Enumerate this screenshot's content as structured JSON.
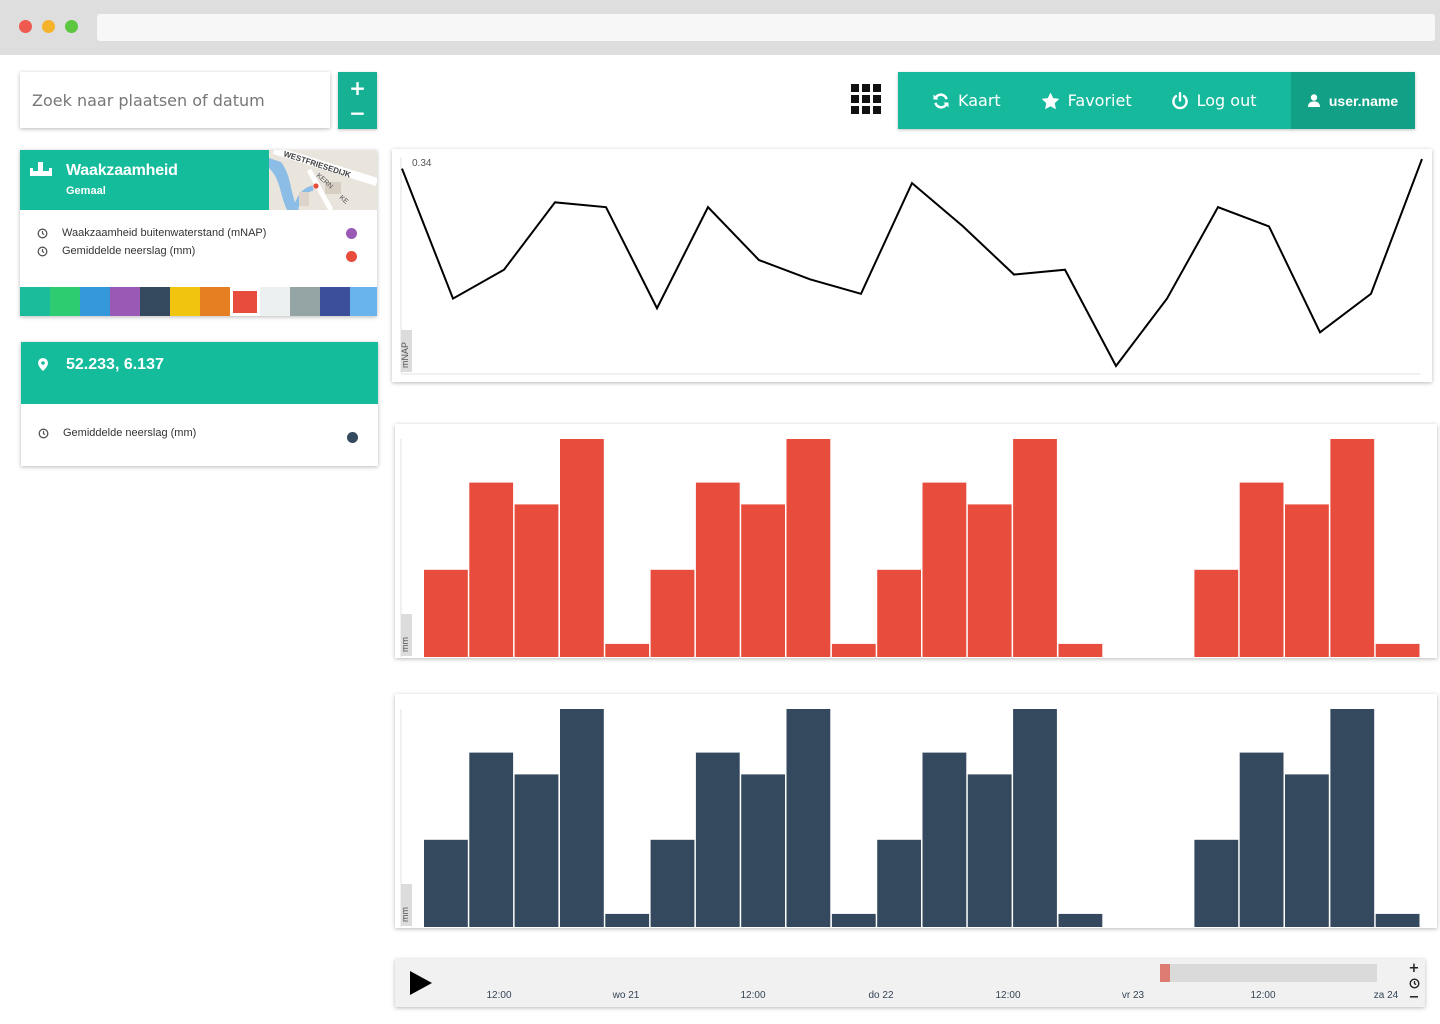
{
  "search": {
    "placeholder": "Zoek naar plaatsen of datum"
  },
  "zoom": {
    "in": "+",
    "out": "−"
  },
  "nav": {
    "kaart": "Kaart",
    "favoriet": "Favoriet",
    "logout": "Log out",
    "user": "user.name",
    "icons": [
      "apps-grid-icon",
      "refresh-icon",
      "star-icon",
      "power-icon",
      "user-icon"
    ]
  },
  "asset_card": {
    "title": "Waakzaamheid",
    "subtitle": "Gemaal",
    "map_labels": [
      "WESTFRIESEDIJK",
      "KERN",
      "KE"
    ],
    "series": [
      {
        "label": "Waakzaamheid buitenwaterstand (mNAP)",
        "color": "#9b59b6"
      },
      {
        "label": "Gemiddelde neerslag (mm)",
        "color": "#e74c3c"
      }
    ],
    "palette": [
      "#1abc9c",
      "#2ecc71",
      "#3498db",
      "#9b59b6",
      "#34495e",
      "#f1c40f",
      "#e67e22",
      "#e74c3c",
      "#ecf0f1",
      "#95a5a6",
      "#3b4f9a",
      "#6ab4ee"
    ],
    "selected_color": "#e74c3c"
  },
  "point_card": {
    "title": "52.233, 6.137",
    "series": [
      {
        "label": "Gemiddelde neerslag (mm)",
        "color": "#34495e"
      }
    ]
  },
  "chart_data": [
    {
      "type": "line",
      "ylabel": "mNAP",
      "ymax_label": "0.34",
      "color": "#000000",
      "x": [
        0,
        1,
        2,
        3,
        4,
        5,
        6,
        7,
        8,
        9,
        10,
        11,
        12,
        13,
        14,
        15,
        16,
        17,
        18,
        19
      ],
      "values": [
        0.32,
        0.05,
        0.11,
        0.25,
        0.24,
        0.03,
        0.24,
        0.13,
        0.09,
        0.06,
        0.29,
        0.2,
        0.1,
        0.11,
        -0.09,
        0.05,
        0.24,
        0.2,
        -0.02,
        0.06,
        0.34
      ],
      "ylim": [
        -0.09,
        0.34
      ]
    },
    {
      "type": "bar",
      "ylabel": "mm",
      "color": "#e74c3c",
      "values": [
        4,
        8,
        7,
        10,
        0.6,
        4,
        8,
        7,
        10,
        0.6,
        4,
        8,
        7,
        10,
        0.6,
        0,
        0,
        4,
        8,
        7,
        10,
        0.6
      ],
      "ylim": [
        0,
        10
      ]
    },
    {
      "type": "bar",
      "ylabel": "mm",
      "color": "#34495e",
      "values": [
        4,
        8,
        7,
        10,
        0.6,
        4,
        8,
        7,
        10,
        0.6,
        4,
        8,
        7,
        10,
        0.6,
        0,
        0,
        4,
        8,
        7,
        10,
        0.6
      ],
      "ylim": [
        0,
        10
      ]
    }
  ],
  "timeline": {
    "ticks": [
      "12:00",
      "wo 21",
      "12:00",
      "do 22",
      "12:00",
      "vr 23",
      "12:00",
      "za 24"
    ],
    "controls": {
      "zoom_in": "+",
      "zoom_out": "−"
    }
  }
}
